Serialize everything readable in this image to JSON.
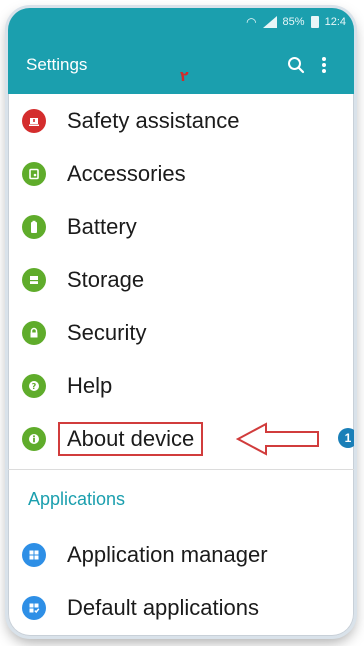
{
  "status_bar": {
    "battery": "85%",
    "time": "12:4"
  },
  "app_bar": {
    "title": "Settings",
    "search_icon": "search-icon",
    "more_icon": "more-vert-icon"
  },
  "annotation_mark": "٢",
  "settings_items": [
    {
      "label": "Safety assistance",
      "icon": "safety-alert-icon",
      "color": "#d42d2d"
    },
    {
      "label": "Accessories",
      "icon": "accessories-icon",
      "color": "#5fac2b"
    },
    {
      "label": "Battery",
      "icon": "battery-icon",
      "color": "#5fac2b"
    },
    {
      "label": "Storage",
      "icon": "storage-icon",
      "color": "#5fac2b"
    },
    {
      "label": "Security",
      "icon": "lock-icon",
      "color": "#5fac2b"
    },
    {
      "label": "Help",
      "icon": "help-icon",
      "color": "#5fac2b"
    },
    {
      "label": "About device",
      "icon": "info-icon",
      "color": "#5fac2b"
    }
  ],
  "step_badge": "1",
  "applications_section": {
    "header": "Applications",
    "items": [
      {
        "label": "Application manager",
        "icon": "app-grid-icon",
        "color": "#2e8fe6"
      },
      {
        "label": "Default applications",
        "icon": "default-apps-icon",
        "color": "#2e8fe6"
      }
    ]
  },
  "colors": {
    "accent": "#1b9fae",
    "highlight": "#d13c3c",
    "badge": "#1a7fb8"
  }
}
